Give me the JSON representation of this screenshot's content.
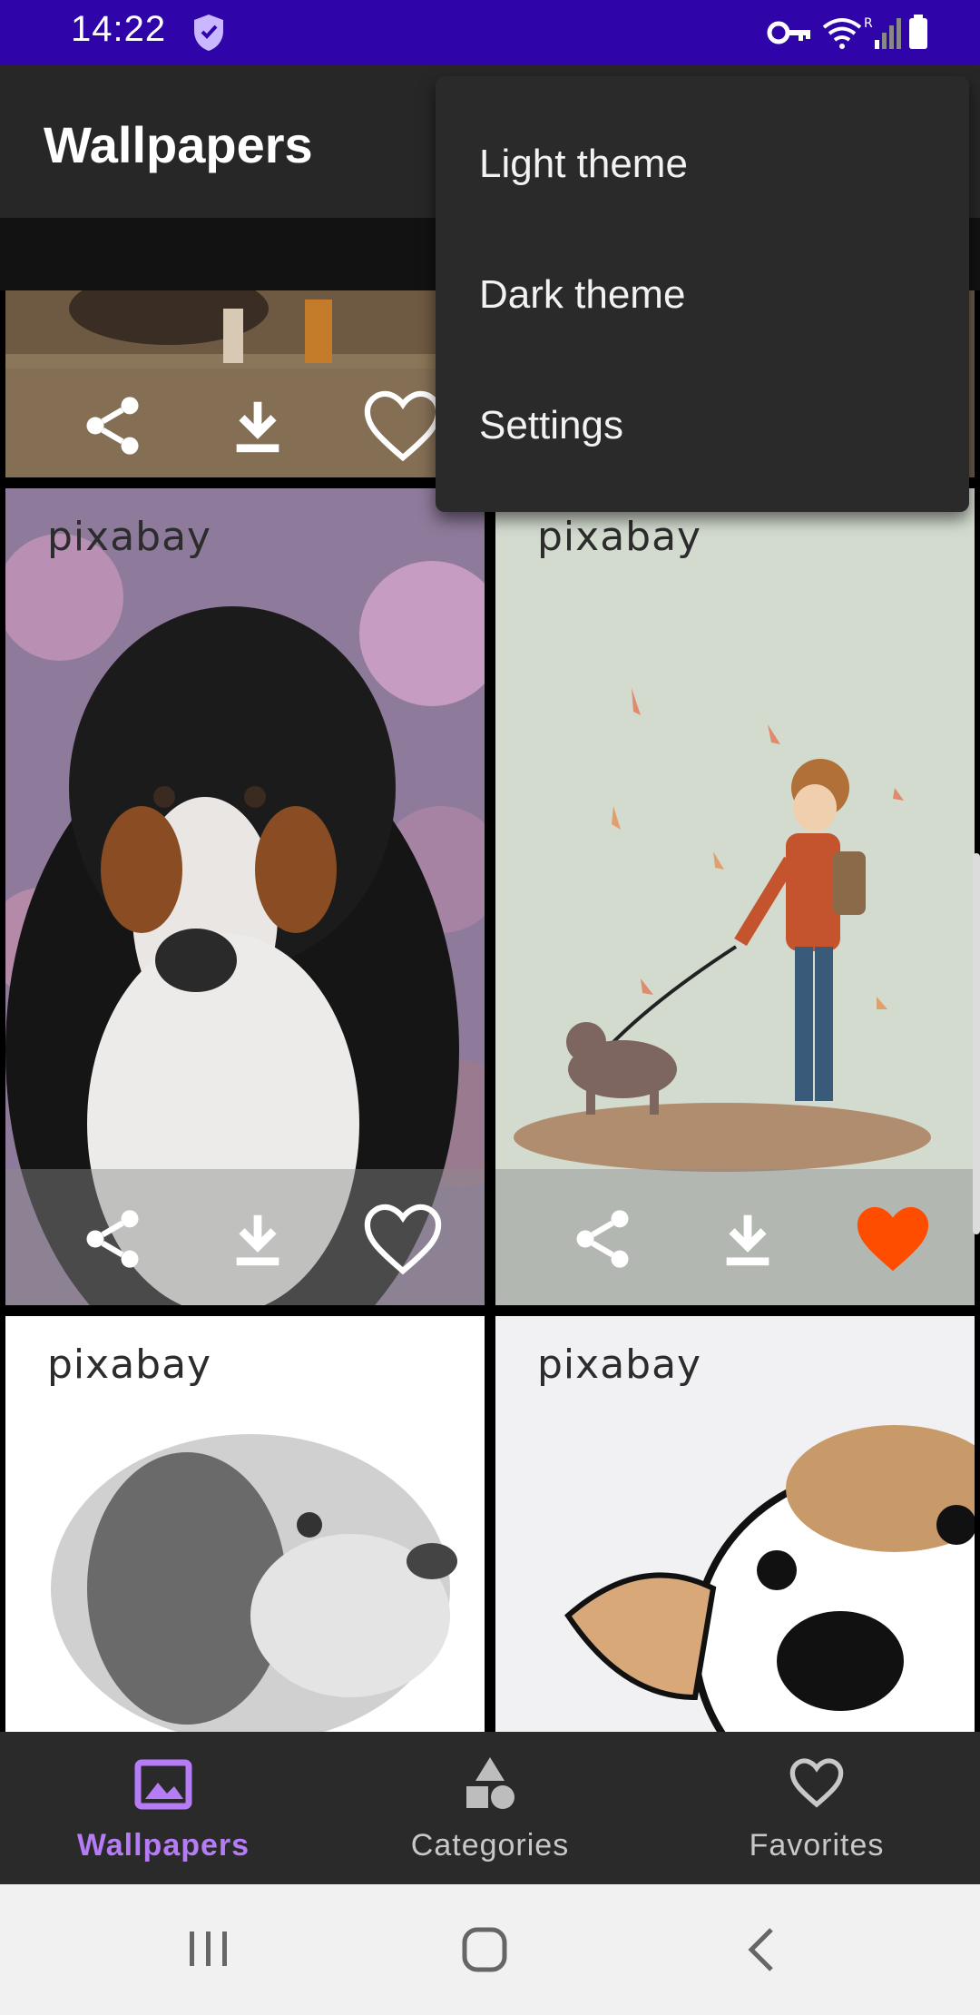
{
  "status_bar": {
    "time": "14:22",
    "background": "#2f04a8"
  },
  "app_bar": {
    "title": "Wallpapers"
  },
  "overflow_menu": {
    "items": [
      {
        "label": "Light theme"
      },
      {
        "label": "Dark theme"
      },
      {
        "label": "Settings"
      }
    ]
  },
  "grid": {
    "tiles": [
      {
        "description": "dog-photo-partial",
        "favorited": false
      },
      {
        "description": "bernese-mountain-dog",
        "watermark": "pixabay",
        "favorited": false
      },
      {
        "description": "boy-walking-dog-illustration",
        "watermark": "pixabay",
        "favorited": true
      },
      {
        "description": "dog-pencil-sketch",
        "watermark": "pixabay"
      },
      {
        "description": "cartoon-dog",
        "watermark": "pixabay"
      }
    ],
    "favorite_color": "#ff4d00"
  },
  "bottom_nav": {
    "active_color": "#b57cf5",
    "items": [
      {
        "label": "Wallpapers",
        "icon": "image-icon",
        "active": true
      },
      {
        "label": "Categories",
        "icon": "shapes-icon",
        "active": false
      },
      {
        "label": "Favorites",
        "icon": "heart-outline-icon",
        "active": false
      }
    ]
  },
  "system_nav": {
    "buttons": [
      "recents-icon",
      "home-icon",
      "back-icon"
    ]
  }
}
